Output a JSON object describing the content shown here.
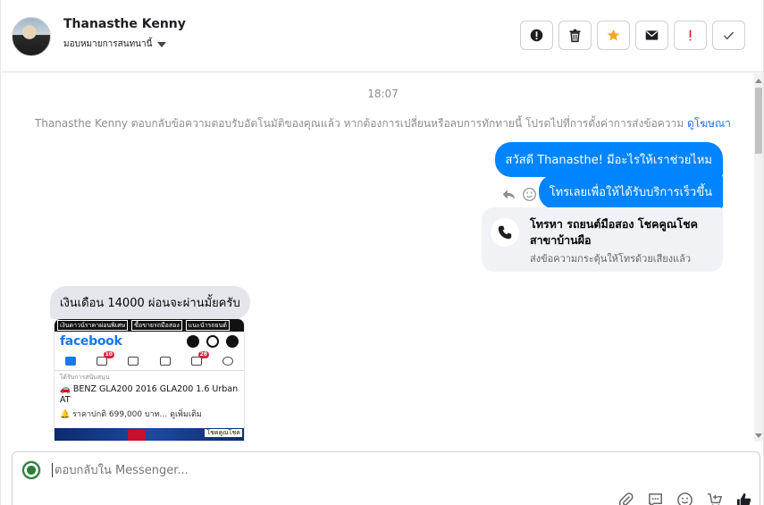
{
  "header": {
    "contact_name": "Thanasthe Kenny",
    "assign_label": "มอบหมายการสนทนานี้",
    "actions": [
      {
        "name": "report-spam-button",
        "icon": "alert-circle-icon"
      },
      {
        "name": "delete-button",
        "icon": "trash-icon"
      },
      {
        "name": "star-button",
        "icon": "star-icon",
        "color": "#f5a623"
      },
      {
        "name": "mark-unread-button",
        "icon": "envelope-icon"
      },
      {
        "name": "mark-important-button",
        "icon": "exclamation-icon",
        "color": "#e41e3f"
      },
      {
        "name": "mark-done-button",
        "icon": "check-icon"
      }
    ]
  },
  "thread": {
    "timestamp": "18:07",
    "notice": "Thanasthe Kenny ตอบกลับข้อความตอบรับอัตโนมัติของคุณแล้ว หากต้องการเปลี่ยนหรือลบการทักทายนี้ โปรดไปที่การตั้งค่าการส่งข้อความ",
    "notice_link": "ดูโฆษณา",
    "outgoing": [
      "สวัสดี Thanasthe! มีอะไรให้เราช่วยไหม",
      "โทรเลยเพื่อให้ได้รับบริการเร็วขึ้น"
    ],
    "call_card": {
      "title": "โทรหา รถยนต์มือสอง โชคคูณโชค สาขาบ้านผือ",
      "subtitle": "ส่งข้อความกระตุ้นให้โทรด้วยเสียงแล้ว"
    },
    "incoming": "เงินเดือน 14000 ผ่อนจะผ่านมั้ยครับ",
    "attachment": {
      "top_tags": [
        "เงินดาวน์ราคาผ่อนพิเศษ",
        "ซื้อขายรถมือสอง",
        "แนะนำรถยนต์"
      ],
      "brand": "facebook",
      "badges": [
        "10",
        "28"
      ],
      "sponsored": "ได้รับการสนับสนุน",
      "ad_title": "BENZ GLA200 2016 GLA200 1.6 Urban AT",
      "ad_price": "ราคาปกติ 699,000 บาท... ดูเพิ่มเติม",
      "footer_tag": "โชคคูณโชค"
    }
  },
  "composer": {
    "placeholder": "ตอบกลับใน Messenger..."
  },
  "colors": {
    "messenger_blue": "#0084ff",
    "link_blue": "#1877f2",
    "incoming_bubble": "#e4e6eb"
  }
}
